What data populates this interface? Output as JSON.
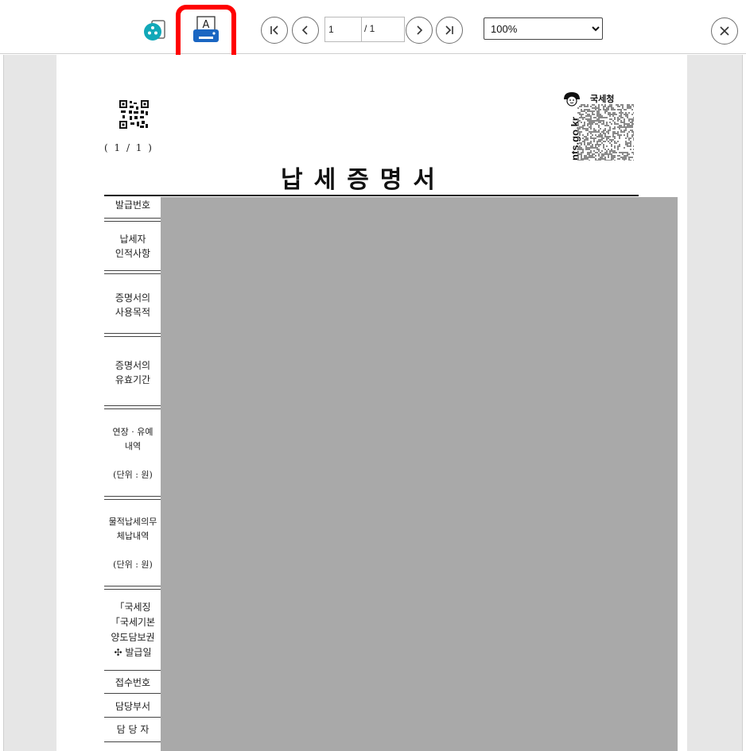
{
  "toolbar": {
    "page_current": "1",
    "page_total": "/ 1",
    "zoom_value": "100%",
    "zoom_options": [
      "100%"
    ],
    "icons": {
      "share": "share-icon",
      "print": "print-icon",
      "first": "first-page-icon",
      "prev": "previous-page-icon",
      "next": "next-page-icon",
      "last": "last-page-icon",
      "close": "close-icon"
    },
    "highlight_color": "#ff0000"
  },
  "document": {
    "page_count": "( 1 / 1 )",
    "title": "납세증명서",
    "agency": "국세청",
    "agency_url": "nts.go.kr",
    "rows": [
      {
        "lines": [
          "발급번호"
        ]
      },
      {
        "lines": [
          "납세자",
          "인적사항"
        ]
      },
      {
        "lines": [
          "증명서의",
          "사용목적"
        ]
      },
      {
        "lines": [
          "증명서의",
          "유효기간"
        ]
      },
      {
        "lines": [
          "연장 · 유예",
          "내역",
          "",
          "(단위 : 원)"
        ]
      },
      {
        "lines": [
          "물적납세의무",
          "체납내역",
          "",
          "(단위 : 원)"
        ]
      },
      {
        "lines": [
          "「국세징",
          "「국세기본",
          "양도담보권",
          "✣ 발급일"
        ]
      },
      {
        "lines": [
          "접수번호"
        ]
      },
      {
        "lines": [
          "담당부서"
        ]
      },
      {
        "lines": [
          "담 당 자"
        ]
      }
    ]
  },
  "colors": {
    "redaction": "#a9a9a9",
    "print_icon_blue": "#1a66c2",
    "share_icon_teal": "#12a8b8"
  }
}
